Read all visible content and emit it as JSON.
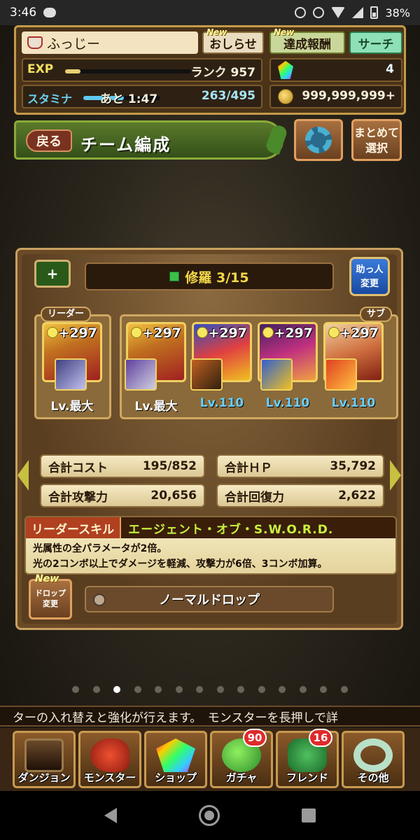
{
  "status_bar": {
    "time": "3:46",
    "battery": "38%"
  },
  "player": {
    "name": "ふっじー",
    "notice_label": "おしらせ",
    "reward_label": "達成報酬",
    "search_label": "サーチ",
    "new_tag": "New",
    "exp_label": "EXP",
    "exp_progress": 0.12,
    "rank": "ランク 957",
    "stamina_label": "スタミナ",
    "stamina_remaining": "あと 1:47",
    "stamina_progress": 0.53,
    "stamina": "263/495",
    "magic_stones": "4",
    "coins": "999,999,999+"
  },
  "header": {
    "back_label": "戻る",
    "title": "チーム編成",
    "multi_select_line1": "まとめて",
    "multi_select_line2": "選択"
  },
  "team": {
    "swap_icon": "+",
    "team_name": "修羅 3/15",
    "helper_line1": "助っ人",
    "helper_line2": "変更",
    "leader_tag": "リーダー",
    "sub_tag": "サブ",
    "members": [
      {
        "plus": "+297",
        "level": "Lv.最大"
      },
      {
        "plus": "+297",
        "level": "Lv.最大"
      },
      {
        "plus": "+297",
        "level": "Lv.110"
      },
      {
        "plus": "+297",
        "level": "Lv.110"
      },
      {
        "plus": "+297",
        "level": "Lv.110"
      }
    ],
    "stats": {
      "cost_label": "合計コスト",
      "cost": "195/852",
      "hp_label": "合計ＨＰ",
      "hp": "35,792",
      "atk_label": "合計攻撃力",
      "atk": "20,656",
      "rcv_label": "合計回復力",
      "rcv": "2,622"
    },
    "leader_skill": {
      "label": "リーダースキル",
      "name": "エージェント・オブ・S.W.O.R.D.",
      "line1": "光属性の全パラメータが2倍。",
      "line2": "光の2コンボ以上でダメージを軽減、攻撃力が6倍、3コンボ加算。"
    },
    "drop": {
      "button_line1": "ドロップ",
      "button_line2": "変更",
      "value": "ノーマルドロップ"
    }
  },
  "pager": {
    "pages": 14,
    "active": 2
  },
  "ticker": "ターの入れ替えと強化が行えます。　モンスターを長押しで詳",
  "nav": [
    {
      "label": "ダンジョン"
    },
    {
      "label": "モンスター"
    },
    {
      "label": "ショップ"
    },
    {
      "label": "ガチャ",
      "badge": "90"
    },
    {
      "label": "フレンド",
      "badge": "16"
    },
    {
      "label": "その他"
    }
  ]
}
